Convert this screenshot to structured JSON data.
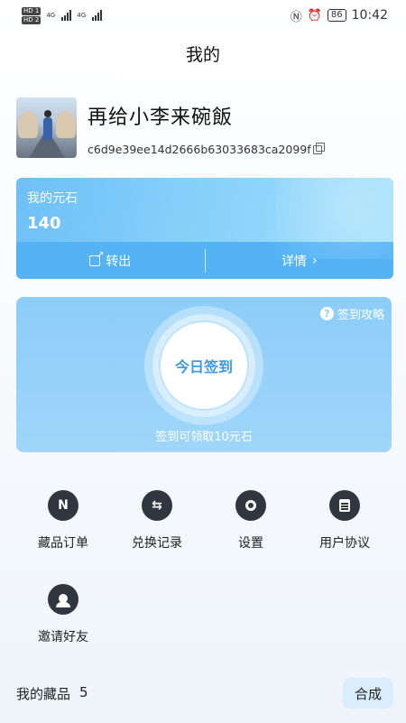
{
  "status_bar": {
    "hd1": "HD 1",
    "hd2": "HD 2",
    "net1": "4G",
    "net2": "4G",
    "battery": "86",
    "time": "10:42"
  },
  "page": {
    "title": "我的"
  },
  "profile": {
    "username": "再给小李来碗飯",
    "address": "c6d9e39ee14d2666b63033683ca2099f"
  },
  "wallet": {
    "label": "我的元石",
    "value": "140",
    "transfer_label": "转出",
    "details_label": "详情",
    "details_chevron": "›"
  },
  "checkin": {
    "guide_label": "签到攻略",
    "button_label": "今日签到",
    "note": "签到可领取10元石"
  },
  "menu": {
    "items": [
      {
        "label": "藏品订单",
        "icon": "n-logo-icon"
      },
      {
        "label": "兑换记录",
        "icon": "exchange-icon"
      },
      {
        "label": "设置",
        "icon": "settings-icon"
      },
      {
        "label": "用户协议",
        "icon": "document-icon"
      },
      {
        "label": "邀请好友",
        "icon": "invite-icon"
      }
    ]
  },
  "collection": {
    "title": "我的藏品",
    "count": "5",
    "synth_label": "合成"
  }
}
